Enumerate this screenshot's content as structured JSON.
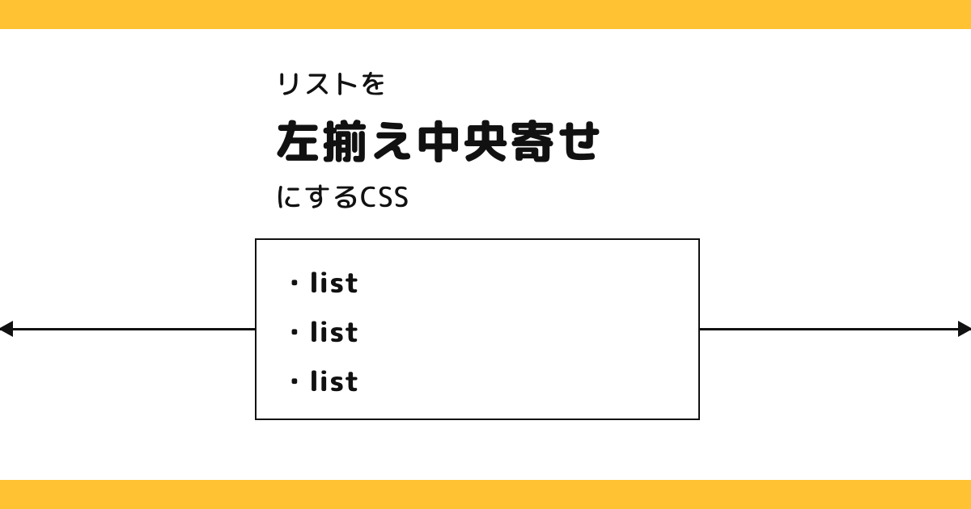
{
  "colors": {
    "accent": "#fec232",
    "text": "#111111",
    "background": "#ffffff"
  },
  "heading": {
    "line1": "リストを",
    "line2": "左揃え中央寄せ",
    "line3": "にするCSS"
  },
  "list": {
    "items": [
      {
        "label": "・list"
      },
      {
        "label": "・list"
      },
      {
        "label": "・list"
      }
    ]
  }
}
